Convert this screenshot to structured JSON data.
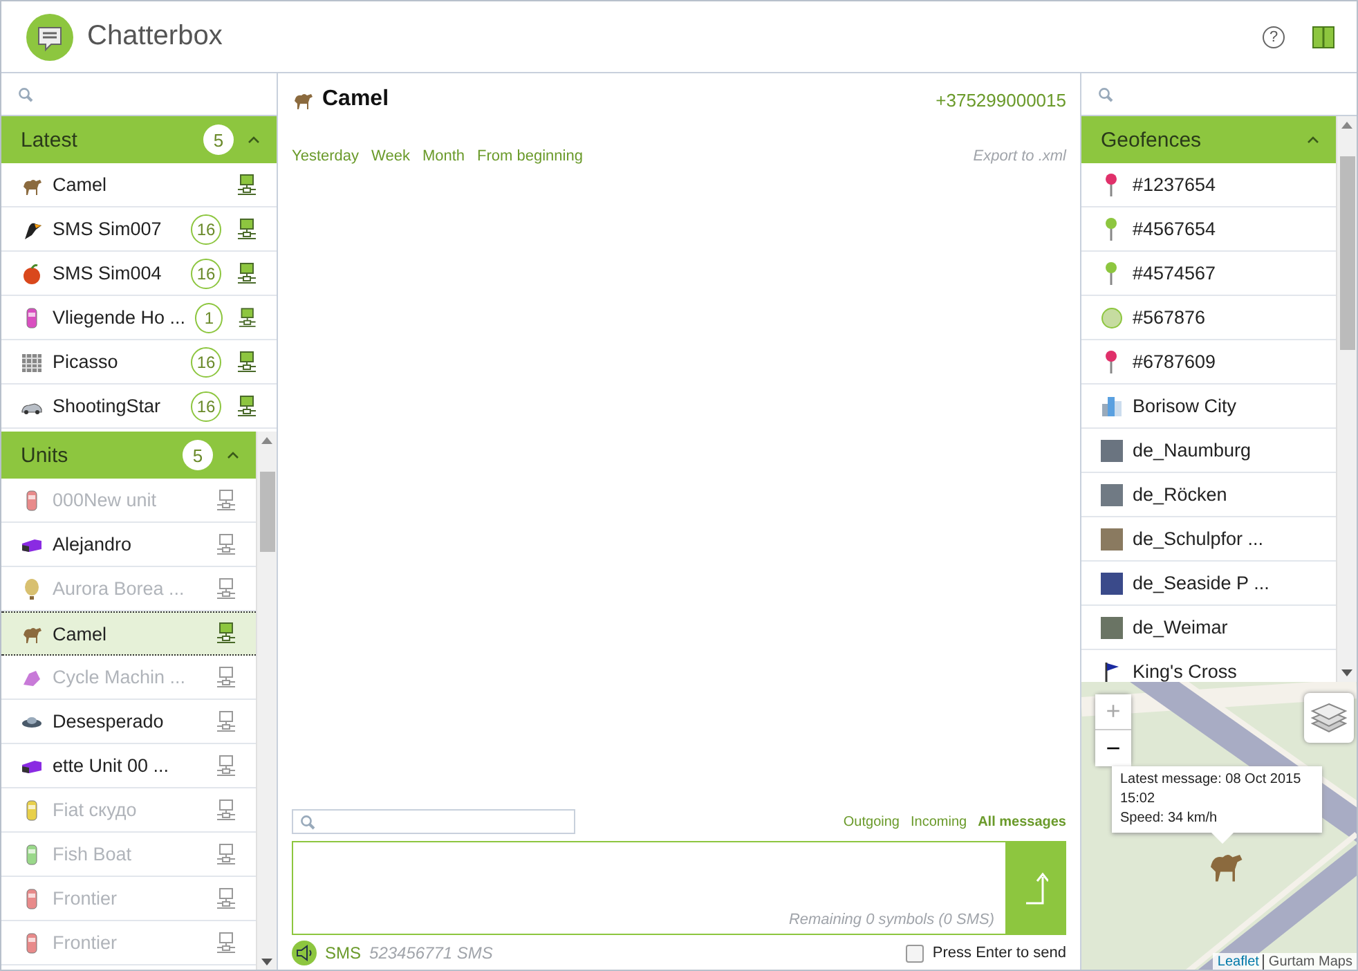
{
  "app": {
    "title": "Chatterbox",
    "help": "?"
  },
  "latest": {
    "title": "Latest",
    "count": "5",
    "expanded": true,
    "items": [
      {
        "name": "Camel",
        "kind": "camel",
        "color": "#8b6a3e",
        "online": true
      },
      {
        "name": "SMS Sim007",
        "kind": "bird",
        "color": "#222222",
        "count": "16",
        "online": true
      },
      {
        "name": "SMS Sim004",
        "kind": "apple",
        "color": "#d9481c",
        "count": "16",
        "online": true
      },
      {
        "name": "Vliegende Ho ...",
        "kind": "car",
        "color": "#d94fc0",
        "count": "1",
        "online": true
      },
      {
        "name": "Picasso",
        "kind": "tile",
        "color": "#888888",
        "count": "16",
        "online": true
      },
      {
        "name": "ShootingStar",
        "kind": "sedan",
        "color": "#b8bec6",
        "count": "16",
        "online": true
      }
    ]
  },
  "units": {
    "title": "Units",
    "count": "5",
    "expanded": true,
    "items": [
      {
        "name": "000New unit",
        "kind": "car",
        "color": "#e88a8a",
        "active": false,
        "selected": false,
        "online": false
      },
      {
        "name": "Alejandro",
        "kind": "truck",
        "color": "#8a2be2",
        "active": true,
        "selected": false,
        "online": false
      },
      {
        "name": "Aurora Borea ...",
        "kind": "balloon",
        "color": "#d8c070",
        "active": false,
        "selected": false,
        "online": false
      },
      {
        "name": "Camel",
        "kind": "camel",
        "color": "#8b6a3e",
        "active": true,
        "selected": true,
        "online": true
      },
      {
        "name": "Cycle Machin ...",
        "kind": "bike",
        "color": "#c87ad8",
        "active": false,
        "selected": false,
        "online": false
      },
      {
        "name": "Desesperado",
        "kind": "saucer",
        "color": "#4a5a6a",
        "active": true,
        "selected": false,
        "online": false
      },
      {
        "name": "ette Unit 00 ...",
        "kind": "truck",
        "color": "#8a2be2",
        "active": true,
        "selected": false,
        "online": false
      },
      {
        "name": "Fiat скудо",
        "kind": "car",
        "color": "#e8d04a",
        "active": false,
        "selected": false,
        "online": false
      },
      {
        "name": "Fish Boat",
        "kind": "car",
        "color": "#9ad88a",
        "active": false,
        "selected": false,
        "online": false
      },
      {
        "name": "Frontier",
        "kind": "car",
        "color": "#e88a8a",
        "active": false,
        "selected": false,
        "online": false
      },
      {
        "name": "Frontier",
        "kind": "car",
        "color": "#e88a8a",
        "active": false,
        "selected": false,
        "online": false
      }
    ]
  },
  "chat": {
    "unit_name": "Camel",
    "phone": "+375299000015",
    "periods": [
      "Yesterday",
      "Week",
      "Month",
      "From beginning"
    ],
    "export": "Export to .xml",
    "filters": [
      {
        "label": "Outgoing",
        "selected": false
      },
      {
        "label": "Incoming",
        "selected": false
      },
      {
        "label": "All messages",
        "selected": true
      }
    ],
    "remaining": "Remaining 0 symbols (0 SMS)",
    "channel": "SMS",
    "channel_number": "523456771 SMS",
    "enter_to_send": {
      "label": "Press Enter to send",
      "checked": false
    }
  },
  "geofences": {
    "title": "Geofences",
    "expanded": true,
    "items": [
      {
        "name": "#1237654",
        "kind": "pin",
        "color": "#e0306a"
      },
      {
        "name": "#4567654",
        "kind": "pin",
        "color": "#8dc63f"
      },
      {
        "name": "#4574567",
        "kind": "pin",
        "color": "#8dc63f"
      },
      {
        "name": "#567876",
        "kind": "circle",
        "color": "#c6dca0"
      },
      {
        "name": "#6787609",
        "kind": "pin",
        "color": "#e0306a"
      },
      {
        "name": "Borisow City",
        "kind": "buildings",
        "color": "#5aa0e0"
      },
      {
        "name": "de_Naumburg",
        "kind": "photo",
        "color": "#6a7480"
      },
      {
        "name": "de_Röcken",
        "kind": "photo",
        "color": "#707a84"
      },
      {
        "name": "de_Schulpfor ...",
        "kind": "photo",
        "color": "#8a7a60"
      },
      {
        "name": "de_Seaside P ...",
        "kind": "photo",
        "color": "#3a4a8a"
      },
      {
        "name": "de_Weimar",
        "kind": "photo",
        "color": "#6a7464"
      },
      {
        "name": "King's Cross",
        "kind": "flag",
        "color": "#1a2aa0"
      }
    ]
  },
  "map": {
    "zoom_in": "+",
    "zoom_out": "−",
    "popup": [
      "Latest message: 08 Oct 2015 15:02",
      "Speed: 34 km/h"
    ],
    "attribution_link": "Leaflet",
    "attribution": "Gurtam Maps"
  }
}
